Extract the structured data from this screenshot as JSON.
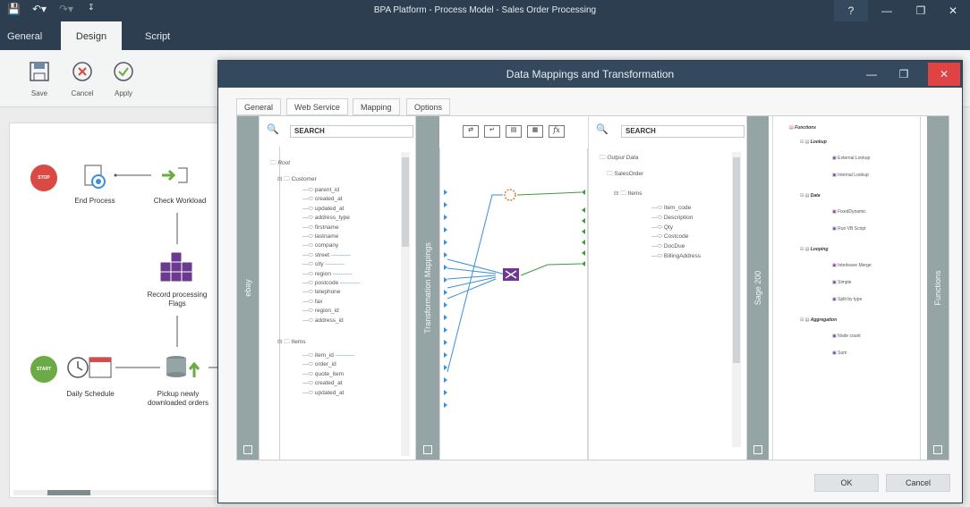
{
  "app": {
    "title": "BPA Platform - Process Model - Sales Order Processing",
    "help_label": "?",
    "tabs": [
      "General",
      "Design",
      "Script"
    ],
    "ribbon": {
      "save": "Save",
      "cancel": "Cancel",
      "apply": "Apply"
    }
  },
  "workflow": {
    "stop_label": "STOP",
    "start_label": "START",
    "nodes": {
      "end_process": "End Process",
      "check_workload": "Check Workload",
      "record_flags": "Record processing Flags",
      "daily_schedule": "Daily Schedule",
      "pickup_orders": "Pickup newly downloaded orders"
    }
  },
  "dialog": {
    "title": "Data Mappings and Transformation",
    "tabs": [
      "General",
      "Web Service",
      "Mapping",
      "Options"
    ],
    "left_strip": "ebay",
    "mid_strip": "Transformation Mappings",
    "right_strip": "Sage 200",
    "fn_strip": "Functions",
    "search_left": "SEARCH",
    "search_right": "SEARCH",
    "fx_label": "fx",
    "source_tree": {
      "root": "Root",
      "customer": "Customer",
      "customer_fields": [
        "parent_id",
        "created_at",
        "updated_at",
        "address_type",
        "firstname",
        "lastname",
        "company",
        "street",
        "city",
        "region",
        "postcode",
        "telephone",
        "fax",
        "region_id",
        "address_id"
      ],
      "items": "Items",
      "item_fields": [
        "item_id",
        "order_id",
        "quote_item",
        "created_at",
        "updated_at"
      ]
    },
    "target_tree": {
      "root": "Output Data",
      "salesorder": "SalesOrder",
      "items": "Items",
      "item_fields": [
        "Item_code",
        "Description",
        "Qty",
        "Costcode",
        "DocDue",
        "BillingAddress"
      ]
    },
    "functions": {
      "title": "Functions",
      "groups": [
        {
          "name": "Lookup",
          "items": [
            "External Lookup",
            "Internal Lookup"
          ]
        },
        {
          "name": "Data",
          "items": [
            "FixedDynamic",
            "Run VB Script"
          ]
        },
        {
          "name": "Looping",
          "items": [
            "Interleave Merge",
            "Simple",
            "Split by type"
          ]
        },
        {
          "name": "Aggregation",
          "items": [
            "Node count",
            "Sum"
          ]
        }
      ]
    },
    "ok": "OK",
    "cancel": "Cancel"
  },
  "colors": {
    "titlebar": "#2c3e50",
    "stop": "#d94a45",
    "start": "#6aab45",
    "purple": "#6b3a8e",
    "green_link": "#3e9a3a",
    "blue_link": "#3a8fd8"
  }
}
